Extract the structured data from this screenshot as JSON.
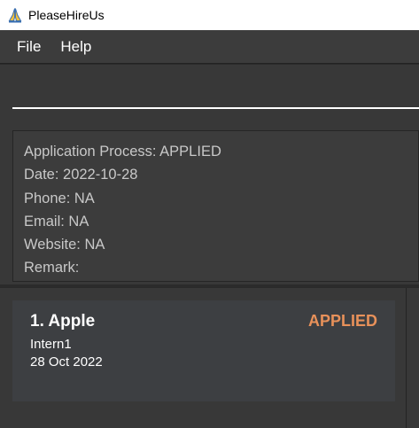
{
  "window": {
    "title": "PleaseHireUs",
    "icon": "praying-hands-icon"
  },
  "menu": {
    "file": "File",
    "help": "Help"
  },
  "command": {
    "value": ""
  },
  "details": {
    "process": "Application Process: APPLIED",
    "date": "Date: 2022-10-28",
    "phone": "Phone: NA",
    "email": "Email: NA",
    "website": "Website: NA",
    "remark": "Remark:"
  },
  "internships": [
    {
      "index_name": "1.  Apple",
      "status": "APPLIED",
      "status_color": "#e8915a",
      "position": "Intern1",
      "date": "28 Oct 2022"
    }
  ]
}
